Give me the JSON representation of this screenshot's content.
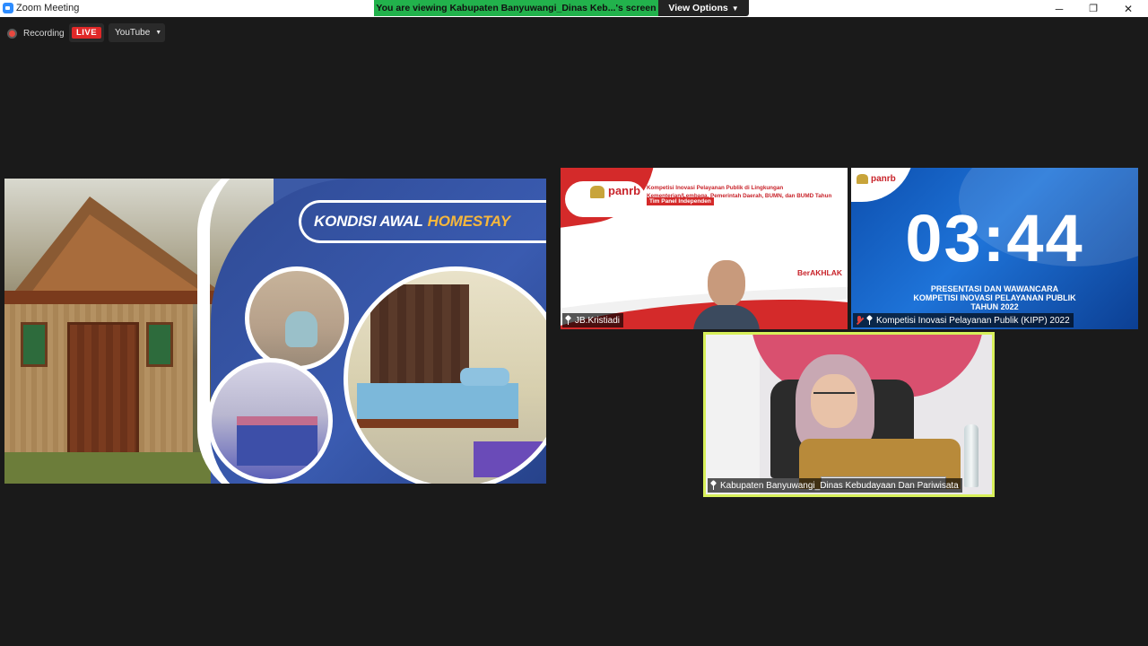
{
  "window": {
    "title": "Zoom Meeting",
    "minimize_glyph": "─",
    "restore_glyph": "❐",
    "close_glyph": "✕"
  },
  "share_banner": {
    "text": "You are viewing Kabupaten Banyuwangi_Dinas Keb...'s screen",
    "view_options_label": "View Options"
  },
  "recording_bar": {
    "recording_label": "Recording",
    "live_label": "LIVE",
    "stream_target": "YouTube"
  },
  "shared_screen": {
    "title_prefix": "KONDISI AWAL ",
    "title_highlight": "HOMESTAY"
  },
  "tiles": [
    {
      "name": "JB.Kristiadi",
      "slide_logo": "panrb",
      "slide_heading": "Kompetisi Inovasi Pelayanan Publik di Lingkungan Kementerian/Lembaga, Pemerintah Daerah, BUMN, dan BUMD Tahun 2022",
      "slide_tag": "Tim Panel Independen",
      "slide_brand": "BerAKHLAK"
    },
    {
      "name": "Kompetisi Inovasi Pelayanan Publik (KIPP) 2022",
      "slide_logo": "panrb",
      "timer": "03:44",
      "caption_line1": "PRESENTASI DAN WAWANCARA",
      "caption_line2": "KOMPETISI INOVASI PELAYANAN PUBLIK",
      "caption_line3": "TAHUN 2022",
      "mic_muted": true
    },
    {
      "name": "Kabupaten Banyuwangi_Dinas Kebudayaan Dan Pariwisata",
      "active_speaker": true,
      "highlight_color": "#d8f05a"
    }
  ],
  "colors": {
    "meeting_bg": "#1a1a1a",
    "banner_green": "#22b24c",
    "live_red": "#e02828",
    "homestay_accent": "#f6b73c",
    "panrb_red": "#c8232a"
  }
}
